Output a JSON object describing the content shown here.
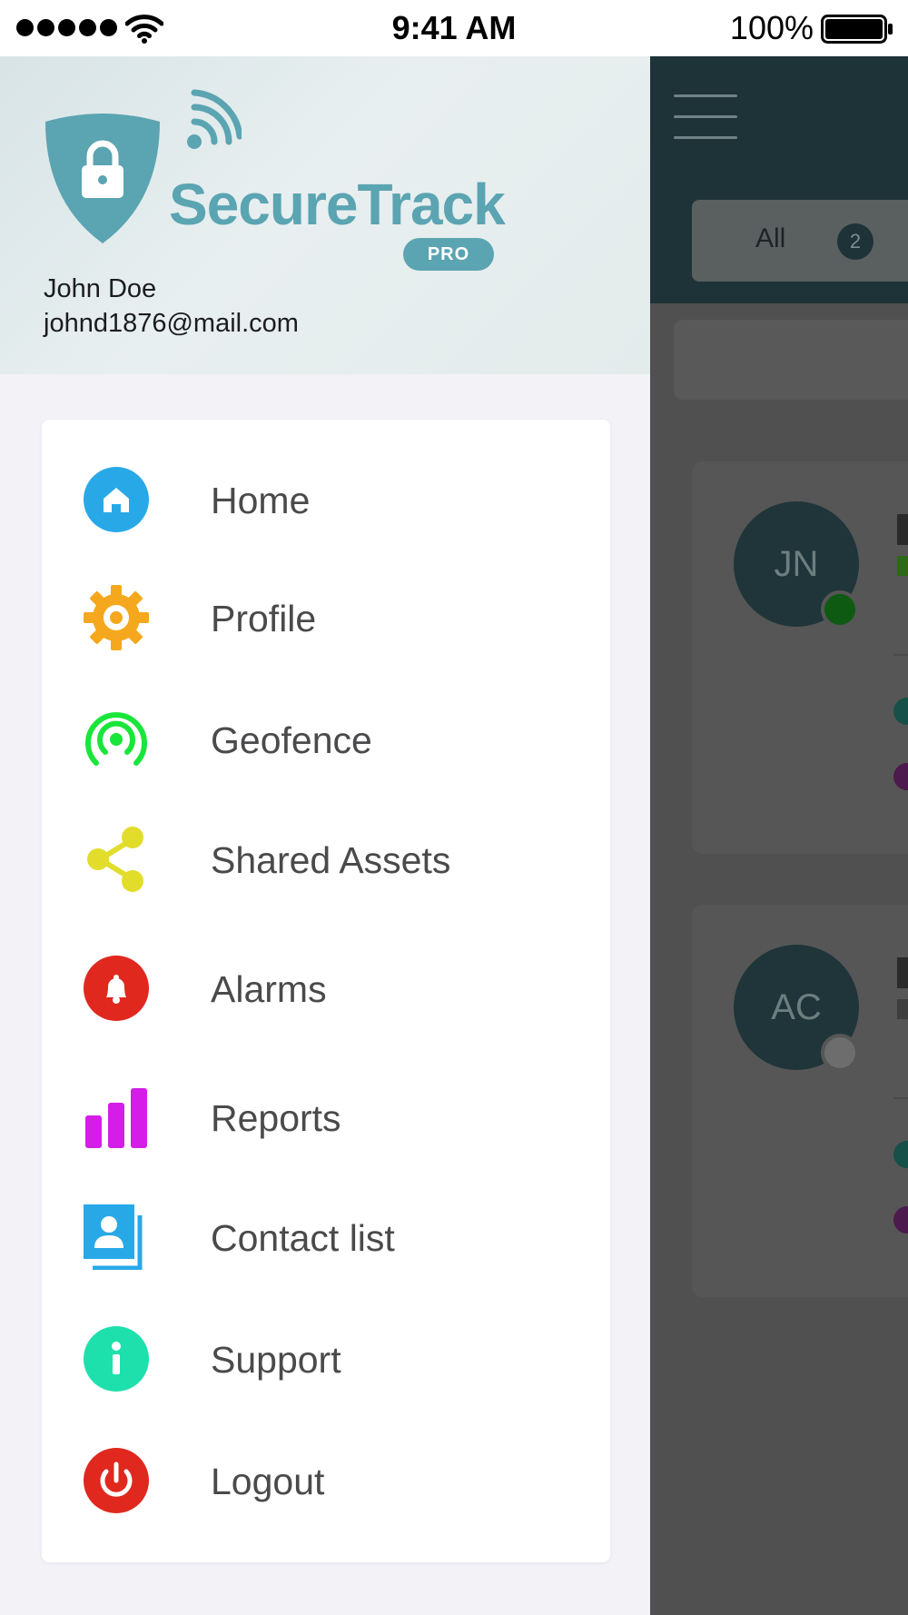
{
  "status_bar": {
    "time": "9:41 AM",
    "battery": "100%"
  },
  "drawer": {
    "logo": {
      "name": "SecureTrack",
      "badge": "PRO",
      "color": "#5ba4b2"
    },
    "user": {
      "name": "John Doe",
      "email": "johnd1876@mail.com"
    },
    "menu": [
      {
        "label": "Home",
        "icon": "home-icon",
        "color": "#29a8e8"
      },
      {
        "label": "Profile",
        "icon": "gear-icon",
        "color": "#f5a81d"
      },
      {
        "label": "Geofence",
        "icon": "geofence-icon",
        "color": "#19e63a"
      },
      {
        "label": "Shared Assets",
        "icon": "share-icon",
        "color": "#e2dd2b"
      },
      {
        "label": "Alarms",
        "icon": "bell-icon",
        "color": "#e0281e"
      },
      {
        "label": "Reports",
        "icon": "bar-chart-icon",
        "color": "#d41ee8"
      },
      {
        "label": "Contact list",
        "icon": "contact-list-icon",
        "color": "#29a8e8"
      },
      {
        "label": "Support",
        "icon": "info-icon",
        "color": "#1ee0ac"
      },
      {
        "label": "Logout",
        "icon": "power-icon",
        "color": "#e0281e"
      }
    ]
  },
  "background_app": {
    "tab_all": {
      "label": "All",
      "count": "2"
    },
    "contacts": [
      {
        "initials": "JN",
        "status": "online"
      },
      {
        "initials": "AC",
        "status": "offline"
      }
    ]
  }
}
